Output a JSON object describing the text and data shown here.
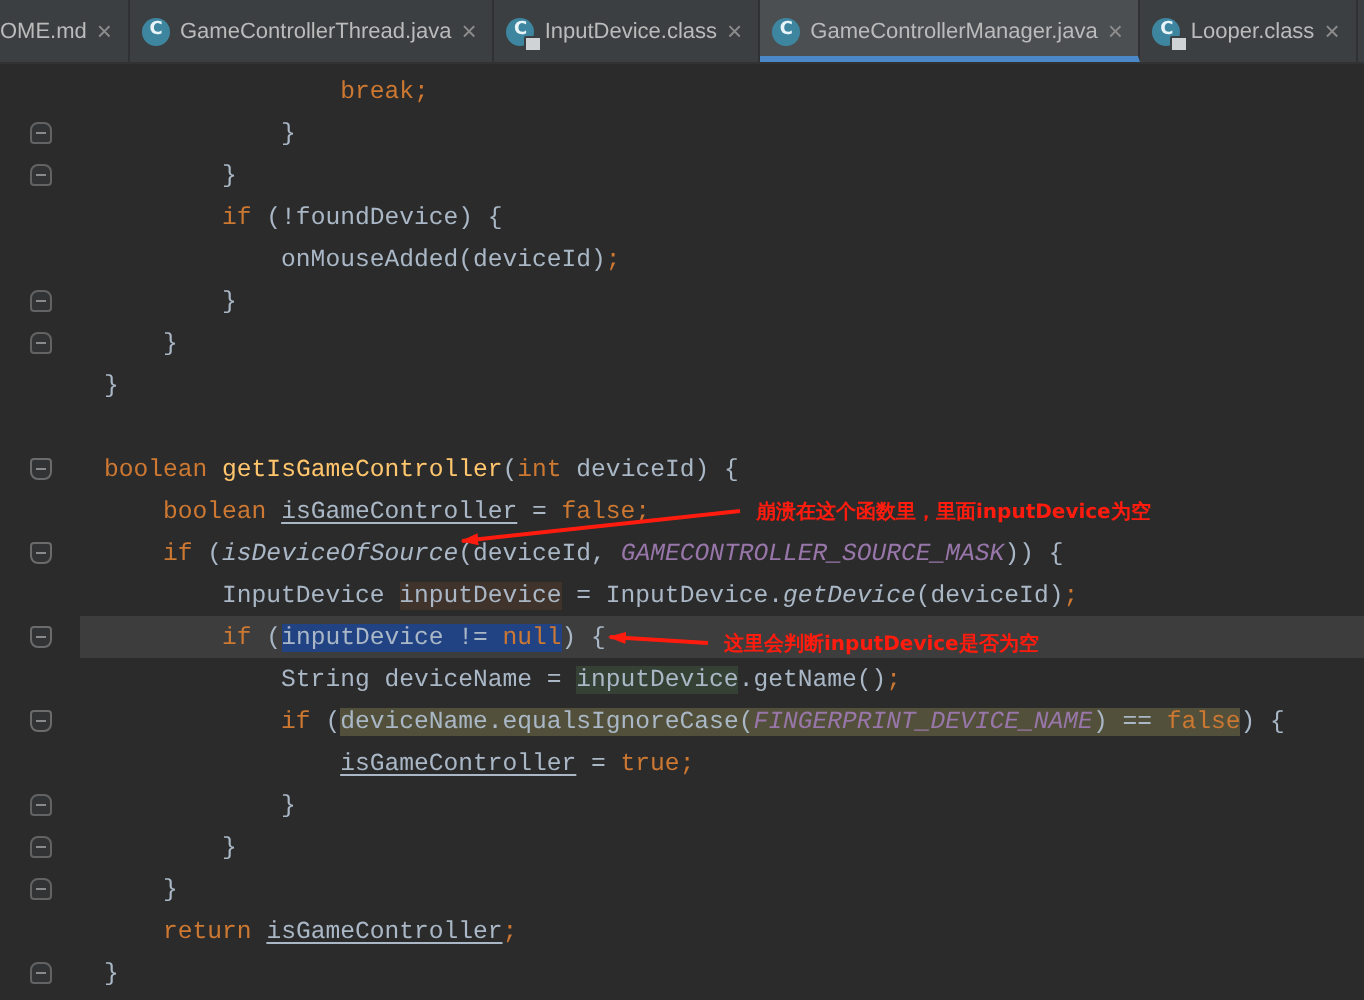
{
  "tabs": [
    {
      "label": "OME.md",
      "locked": false,
      "selected": false,
      "close": "×"
    },
    {
      "label": "GameControllerThread.java",
      "icon_letter": "C",
      "locked": false,
      "selected": false,
      "close": "×"
    },
    {
      "label": "InputDevice.class",
      "icon_letter": "C",
      "locked": true,
      "selected": false,
      "close": "×"
    },
    {
      "label": "GameControllerManager.java",
      "icon_letter": "C",
      "locked": false,
      "selected": true,
      "close": "×"
    },
    {
      "label": "Looper.class",
      "icon_letter": "C",
      "locked": true,
      "selected": false,
      "close": "×"
    }
  ],
  "code_lines": [
    {
      "fold_start": false,
      "fold_end": false,
      "current": false,
      "tokens": [
        {
          "text": "                break;",
          "kind": "keyword"
        }
      ]
    },
    {
      "fold_start": false,
      "fold_end": true,
      "current": false,
      "tokens": [
        {
          "text": "            }",
          "kind": "plain"
        }
      ]
    },
    {
      "fold_start": false,
      "fold_end": true,
      "current": false,
      "tokens": [
        {
          "text": "        }",
          "kind": "plain"
        }
      ]
    },
    {
      "fold_start": false,
      "fold_end": false,
      "current": false,
      "tokens": [
        {
          "text": "        if",
          "kind": "keyword"
        },
        {
          "text": " (!foundDevice) {",
          "kind": "plain"
        }
      ]
    },
    {
      "fold_start": false,
      "fold_end": false,
      "current": false,
      "tokens": [
        {
          "text": "            onMouseAdded(deviceId)",
          "kind": "plain"
        },
        {
          "text": ";",
          "kind": "keyword"
        }
      ]
    },
    {
      "fold_start": false,
      "fold_end": true,
      "current": false,
      "tokens": [
        {
          "text": "        }",
          "kind": "plain"
        }
      ]
    },
    {
      "fold_start": false,
      "fold_end": true,
      "current": false,
      "tokens": [
        {
          "text": "    }",
          "kind": "plain"
        }
      ]
    },
    {
      "fold_start": false,
      "fold_end": false,
      "current": false,
      "tokens": [
        {
          "text": "}",
          "kind": "plain"
        }
      ]
    },
    {
      "fold_start": false,
      "fold_end": false,
      "current": false
    },
    {
      "fold_start": true,
      "fold_end": false,
      "current": false,
      "tokens": [
        {
          "text": "boolean ",
          "kind": "keyword"
        },
        {
          "text": "getIsGameController",
          "kind": "method"
        },
        {
          "text": "(",
          "kind": "plain"
        },
        {
          "text": "int",
          "kind": "keyword"
        },
        {
          "text": " deviceId) {",
          "kind": "plain"
        }
      ]
    },
    {
      "fold_start": false,
      "fold_end": false,
      "current": false,
      "tokens": [
        {
          "text": "    boolean ",
          "kind": "keyword"
        },
        {
          "text": "isGameController",
          "kind": "reassigned"
        },
        {
          "text": " = ",
          "kind": "plain"
        },
        {
          "text": "false;",
          "kind": "keyword"
        }
      ]
    },
    {
      "fold_start": true,
      "fold_end": false,
      "current": false,
      "tokens": [
        {
          "text": "    if",
          "kind": "keyword"
        },
        {
          "text": " (",
          "kind": "plain"
        },
        {
          "text": "isDeviceOfSource",
          "kind": "static"
        },
        {
          "text": "(deviceId, ",
          "kind": "plain"
        },
        {
          "text": "GAMECONTROLLER_SOURCE_MASK",
          "kind": "constant"
        },
        {
          "text": ")) {",
          "kind": "plain"
        }
      ]
    },
    {
      "fold_start": false,
      "fold_end": false,
      "current": false,
      "tokens": [
        {
          "text": "        InputDevice ",
          "kind": "plain"
        },
        {
          "text": "inputDevice",
          "kind": "plain",
          "color": "#40332b"
        },
        {
          "text": " = InputDevice.",
          "kind": "plain"
        },
        {
          "text": "getDevice",
          "kind": "static"
        },
        {
          "text": "(deviceId)",
          "kind": "plain"
        },
        {
          "text": ";",
          "kind": "keyword"
        }
      ]
    },
    {
      "fold_start": true,
      "fold_end": false,
      "current": true,
      "tokens": [
        {
          "text": "        if",
          "kind": "keyword"
        },
        {
          "text": " (",
          "kind": "plain"
        },
        {
          "text": "inputDevice != ",
          "kind": "plain",
          "color": "#214283"
        },
        {
          "text": "null",
          "kind": "keyword",
          "color": "#214283"
        },
        {
          "text": ") {",
          "kind": "plain"
        }
      ]
    },
    {
      "fold_start": false,
      "fold_end": false,
      "current": false,
      "tokens": [
        {
          "text": "            String deviceName = ",
          "kind": "plain"
        },
        {
          "text": "inputDevice",
          "kind": "plain",
          "color": "#344134"
        },
        {
          "text": ".getName()",
          "kind": "plain"
        },
        {
          "text": ";",
          "kind": "keyword"
        }
      ]
    },
    {
      "fold_start": true,
      "fold_end": false,
      "current": false,
      "tokens": [
        {
          "text": "            if",
          "kind": "keyword"
        },
        {
          "text": " (",
          "kind": "plain"
        },
        {
          "text": "deviceName.equalsIgnoreCase(",
          "kind": "plain",
          "color": "#52503a"
        },
        {
          "text": "FINGERPRINT_DEVICE_NAME",
          "kind": "constant",
          "color": "#52503a"
        },
        {
          "text": ") == ",
          "kind": "plain",
          "color": "#52503a"
        },
        {
          "text": "false",
          "kind": "keyword",
          "color": "#52503a"
        },
        {
          "text": ") {",
          "kind": "plain"
        }
      ]
    },
    {
      "fold_start": false,
      "fold_end": false,
      "current": false,
      "tokens": [
        {
          "text": "                isGameController",
          "kind": "reassigned"
        },
        {
          "text": " = ",
          "kind": "plain"
        },
        {
          "text": "true;",
          "kind": "keyword"
        }
      ]
    },
    {
      "fold_start": false,
      "fold_end": true,
      "current": false,
      "tokens": [
        {
          "text": "            }",
          "kind": "plain"
        }
      ]
    },
    {
      "fold_start": false,
      "fold_end": true,
      "current": false,
      "tokens": [
        {
          "text": "        }",
          "kind": "plain"
        }
      ]
    },
    {
      "fold_start": false,
      "fold_end": true,
      "current": false,
      "tokens": [
        {
          "text": "    }",
          "kind": "plain"
        }
      ]
    },
    {
      "fold_start": false,
      "fold_end": false,
      "current": false,
      "tokens": [
        {
          "text": "    return ",
          "kind": "keyword"
        },
        {
          "text": "isGameController",
          "kind": "reassigned"
        },
        {
          "text": ";",
          "kind": "keyword"
        }
      ]
    },
    {
      "fold_start": false,
      "fold_end": true,
      "current": false,
      "tokens": [
        {
          "text": "}",
          "kind": "plain"
        }
      ]
    }
  ],
  "annotations": [
    {
      "text": "崩溃在这个函数里，里面inputDevice为空"
    },
    {
      "text": "这里会判断inputDevice是否为空"
    }
  ]
}
